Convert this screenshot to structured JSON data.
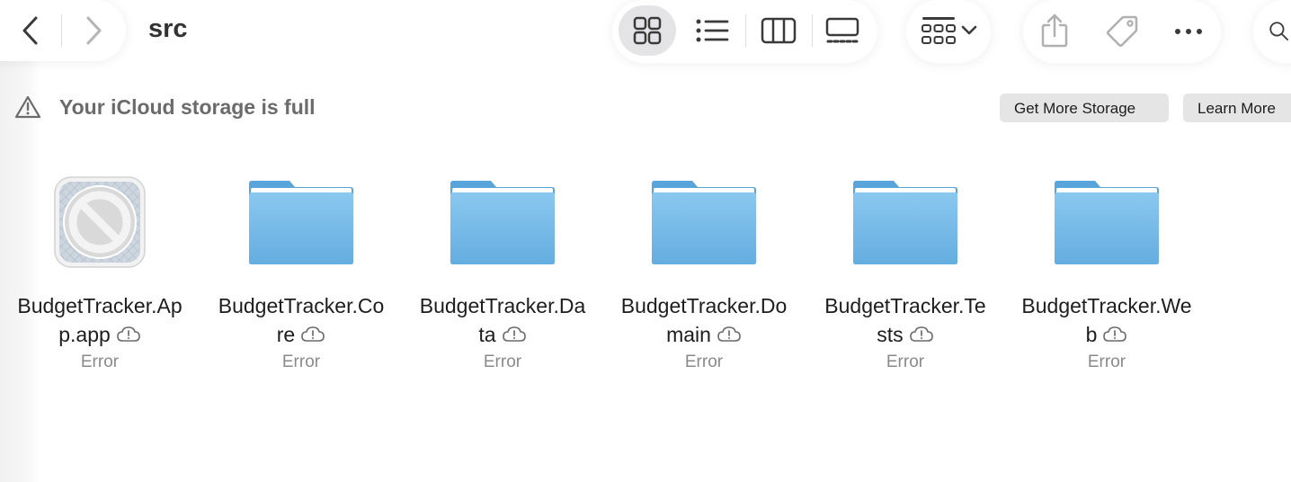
{
  "window": {
    "title": "src"
  },
  "banner": {
    "message": "Your iCloud storage is full",
    "get_more": "Get More Storage",
    "learn_more": "Learn More"
  },
  "toolbar": {
    "icons": [
      "back-icon",
      "forward-icon",
      "icon-view-icon",
      "list-view-icon",
      "column-view-icon",
      "gallery-view-icon",
      "group-icon",
      "share-icon",
      "tag-icon",
      "more-icon",
      "search-icon"
    ],
    "selected_view": "icon-view"
  },
  "items": [
    {
      "line1": "BudgetTracker.Ap",
      "line2": "p.app",
      "status": "Error",
      "type": "app"
    },
    {
      "line1": "BudgetTracker.Co",
      "line2": "re",
      "status": "Error",
      "type": "folder"
    },
    {
      "line1": "BudgetTracker.Da",
      "line2": "ta",
      "status": "Error",
      "type": "folder"
    },
    {
      "line1": "BudgetTracker.Do",
      "line2": "main",
      "status": "Error",
      "type": "folder"
    },
    {
      "line1": "BudgetTracker.Te",
      "line2": "sts",
      "status": "Error",
      "type": "folder"
    },
    {
      "line1": "BudgetTracker.We",
      "line2": "b",
      "status": "Error",
      "type": "folder"
    }
  ],
  "colors": {
    "folder_top": "#8ac8ef",
    "folder_bottom": "#64ade0",
    "accent_gray": "#6b6b6b"
  }
}
